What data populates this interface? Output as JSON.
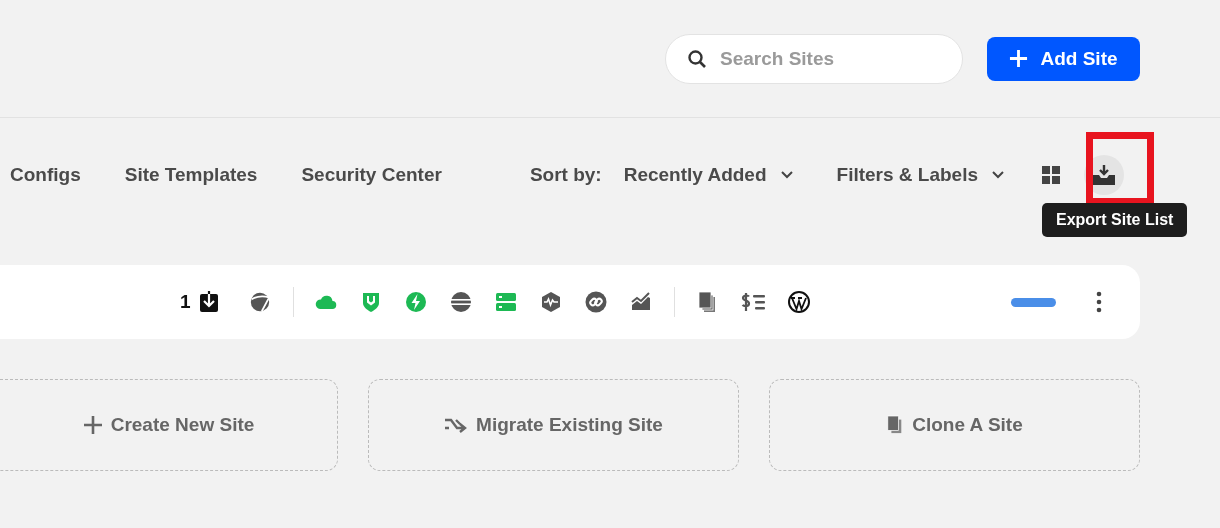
{
  "header": {
    "search": {
      "placeholder": "Search Sites"
    },
    "add_button": {
      "label": "Add Site"
    }
  },
  "nav": {
    "tabs": [
      {
        "label": "Configs"
      },
      {
        "label": "Site Templates"
      },
      {
        "label": "Security Center"
      }
    ],
    "sort": {
      "label": "Sort by:",
      "value": "Recently Added"
    },
    "filters": {
      "label": "Filters & Labels"
    },
    "export": {
      "tooltip": "Export Site List",
      "highlighted": true
    }
  },
  "site_row": {
    "backup_count": "1",
    "features": [
      {
        "kind": "cloud",
        "on": true
      },
      {
        "kind": "shield",
        "on": true
      },
      {
        "kind": "bolt",
        "on": true
      },
      {
        "kind": "stripes",
        "on": false
      },
      {
        "kind": "server",
        "on": true
      },
      {
        "kind": "pulse",
        "on": false
      },
      {
        "kind": "link",
        "on": false
      },
      {
        "kind": "chart",
        "on": false
      }
    ],
    "tools": [
      {
        "kind": "copies"
      },
      {
        "kind": "billing"
      },
      {
        "kind": "wordpress"
      }
    ]
  },
  "actions": [
    {
      "kind": "create",
      "label": "Create New Site"
    },
    {
      "kind": "migrate",
      "label": "Migrate Existing Site"
    },
    {
      "kind": "clone",
      "label": "Clone A Site"
    }
  ]
}
